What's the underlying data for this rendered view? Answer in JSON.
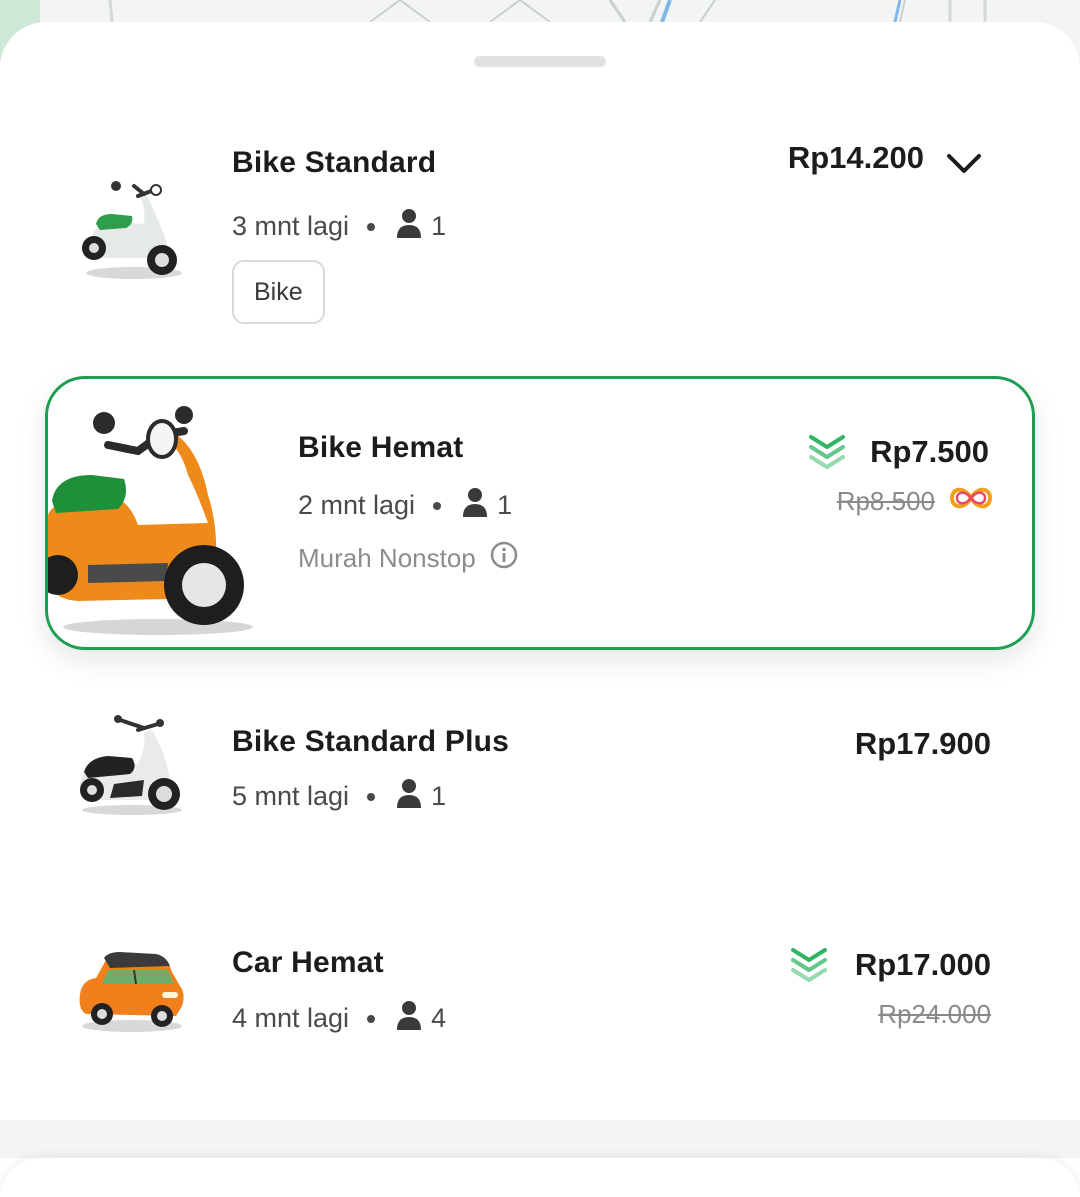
{
  "colors": {
    "accent_green": "#1e9e52",
    "discount_green": "#31b464",
    "text_primary": "#1c1c1c",
    "text_secondary": "#4a4a4a",
    "text_muted": "#8a8a8a"
  },
  "services": [
    {
      "name": "Bike Standard",
      "eta": "3 mnt lagi",
      "seats": "1",
      "price": "Rp14.200",
      "chip": "Bike",
      "icon": "scooter-green-white-icon",
      "expand_icon": "chevron-down-icon"
    },
    {
      "name": "Bike Hemat",
      "eta": "2 mnt lagi",
      "seats": "1",
      "price": "Rp7.500",
      "old_price": "Rp8.500",
      "note": "Murah Nonstop",
      "icon": "scooter-orange-icon",
      "discount_icon": "discount-chevrons-icon",
      "badge_icon": "subscription-loop-icon",
      "selected": true
    },
    {
      "name": "Bike Standard Plus",
      "eta": "5 mnt lagi",
      "seats": "1",
      "price": "Rp17.900",
      "icon": "maxi-scooter-icon"
    },
    {
      "name": "Car Hemat",
      "eta": "4 mnt lagi",
      "seats": "4",
      "price": "Rp17.000",
      "old_price": "Rp24.000",
      "icon": "mini-car-orange-icon",
      "discount_icon": "discount-chevrons-icon"
    }
  ]
}
